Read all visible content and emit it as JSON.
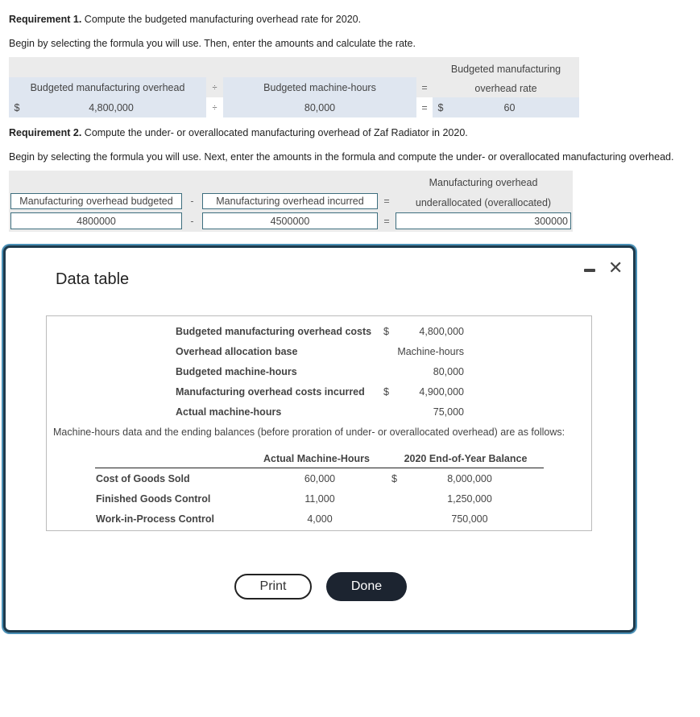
{
  "req1": {
    "title_bold": "Requirement 1.",
    "title_rest": " Compute the budgeted manufacturing overhead rate for 2020.",
    "instruction": "Begin by selecting the formula you will use. Then, enter the amounts and calculate the rate.",
    "formula": {
      "label_1": "Budgeted manufacturing overhead",
      "op_1": "÷",
      "label_2": "Budgeted machine-hours",
      "op_2": "=",
      "result_label_line1": "Budgeted manufacturing",
      "result_label_line2": "overhead rate",
      "currency_1": "$",
      "value_1": "4,800,000",
      "value_op_1": "÷",
      "value_2": "80,000",
      "value_op_2": "=",
      "currency_result": "$",
      "result": "60"
    }
  },
  "req2": {
    "title_bold": "Requirement 2.",
    "title_rest": " Compute the under- or overallocated manufacturing overhead of Zaf Radiator in 2020.",
    "instruction": "Begin by selecting the formula you will use. Next, enter the amounts in the formula and compute the under- or overallocated manufacturing overhead.",
    "formula": {
      "label_1": "Manufacturing overhead budgeted",
      "op_1": "-",
      "label_2": "Manufacturing overhead incurred",
      "op_2": "=",
      "result_label_line1": "Manufacturing overhead",
      "result_label_line2": "underallocated (overallocated)",
      "value_1": "4800000",
      "value_op_1": "-",
      "value_2": "4500000",
      "value_op_2": "=",
      "result": "300000"
    }
  },
  "modal": {
    "title": "Data table",
    "minimize_icon": "minimize-icon",
    "close_icon": "close-icon",
    "close_glyph": "✕",
    "facts": [
      {
        "label": "Budgeted manufacturing overhead costs",
        "currency": "$",
        "value": "4,800,000"
      },
      {
        "label": "Overhead allocation base",
        "currency": "",
        "value": "Machine-hours"
      },
      {
        "label": "Budgeted machine-hours",
        "currency": "",
        "value": "80,000"
      },
      {
        "label": "Manufacturing overhead costs incurred",
        "currency": "$",
        "value": "4,900,000"
      },
      {
        "label": "Actual machine-hours",
        "currency": "",
        "value": "75,000"
      }
    ],
    "note": "Machine-hours data and the ending balances (before proration of under- or overallocated overhead) are as follows:",
    "table": {
      "headers": [
        "",
        "Actual Machine-Hours",
        "2020 End-of-Year Balance"
      ],
      "rows": [
        {
          "account": "Cost of Goods Sold",
          "hours": "60,000",
          "currency": "$",
          "balance": "8,000,000"
        },
        {
          "account": "Finished Goods Control",
          "hours": "11,000",
          "currency": "",
          "balance": "1,250,000"
        },
        {
          "account": "Work-in-Process Control",
          "hours": "4,000",
          "currency": "",
          "balance": "750,000"
        }
      ]
    },
    "print_label": "Print",
    "done_label": "Done"
  }
}
